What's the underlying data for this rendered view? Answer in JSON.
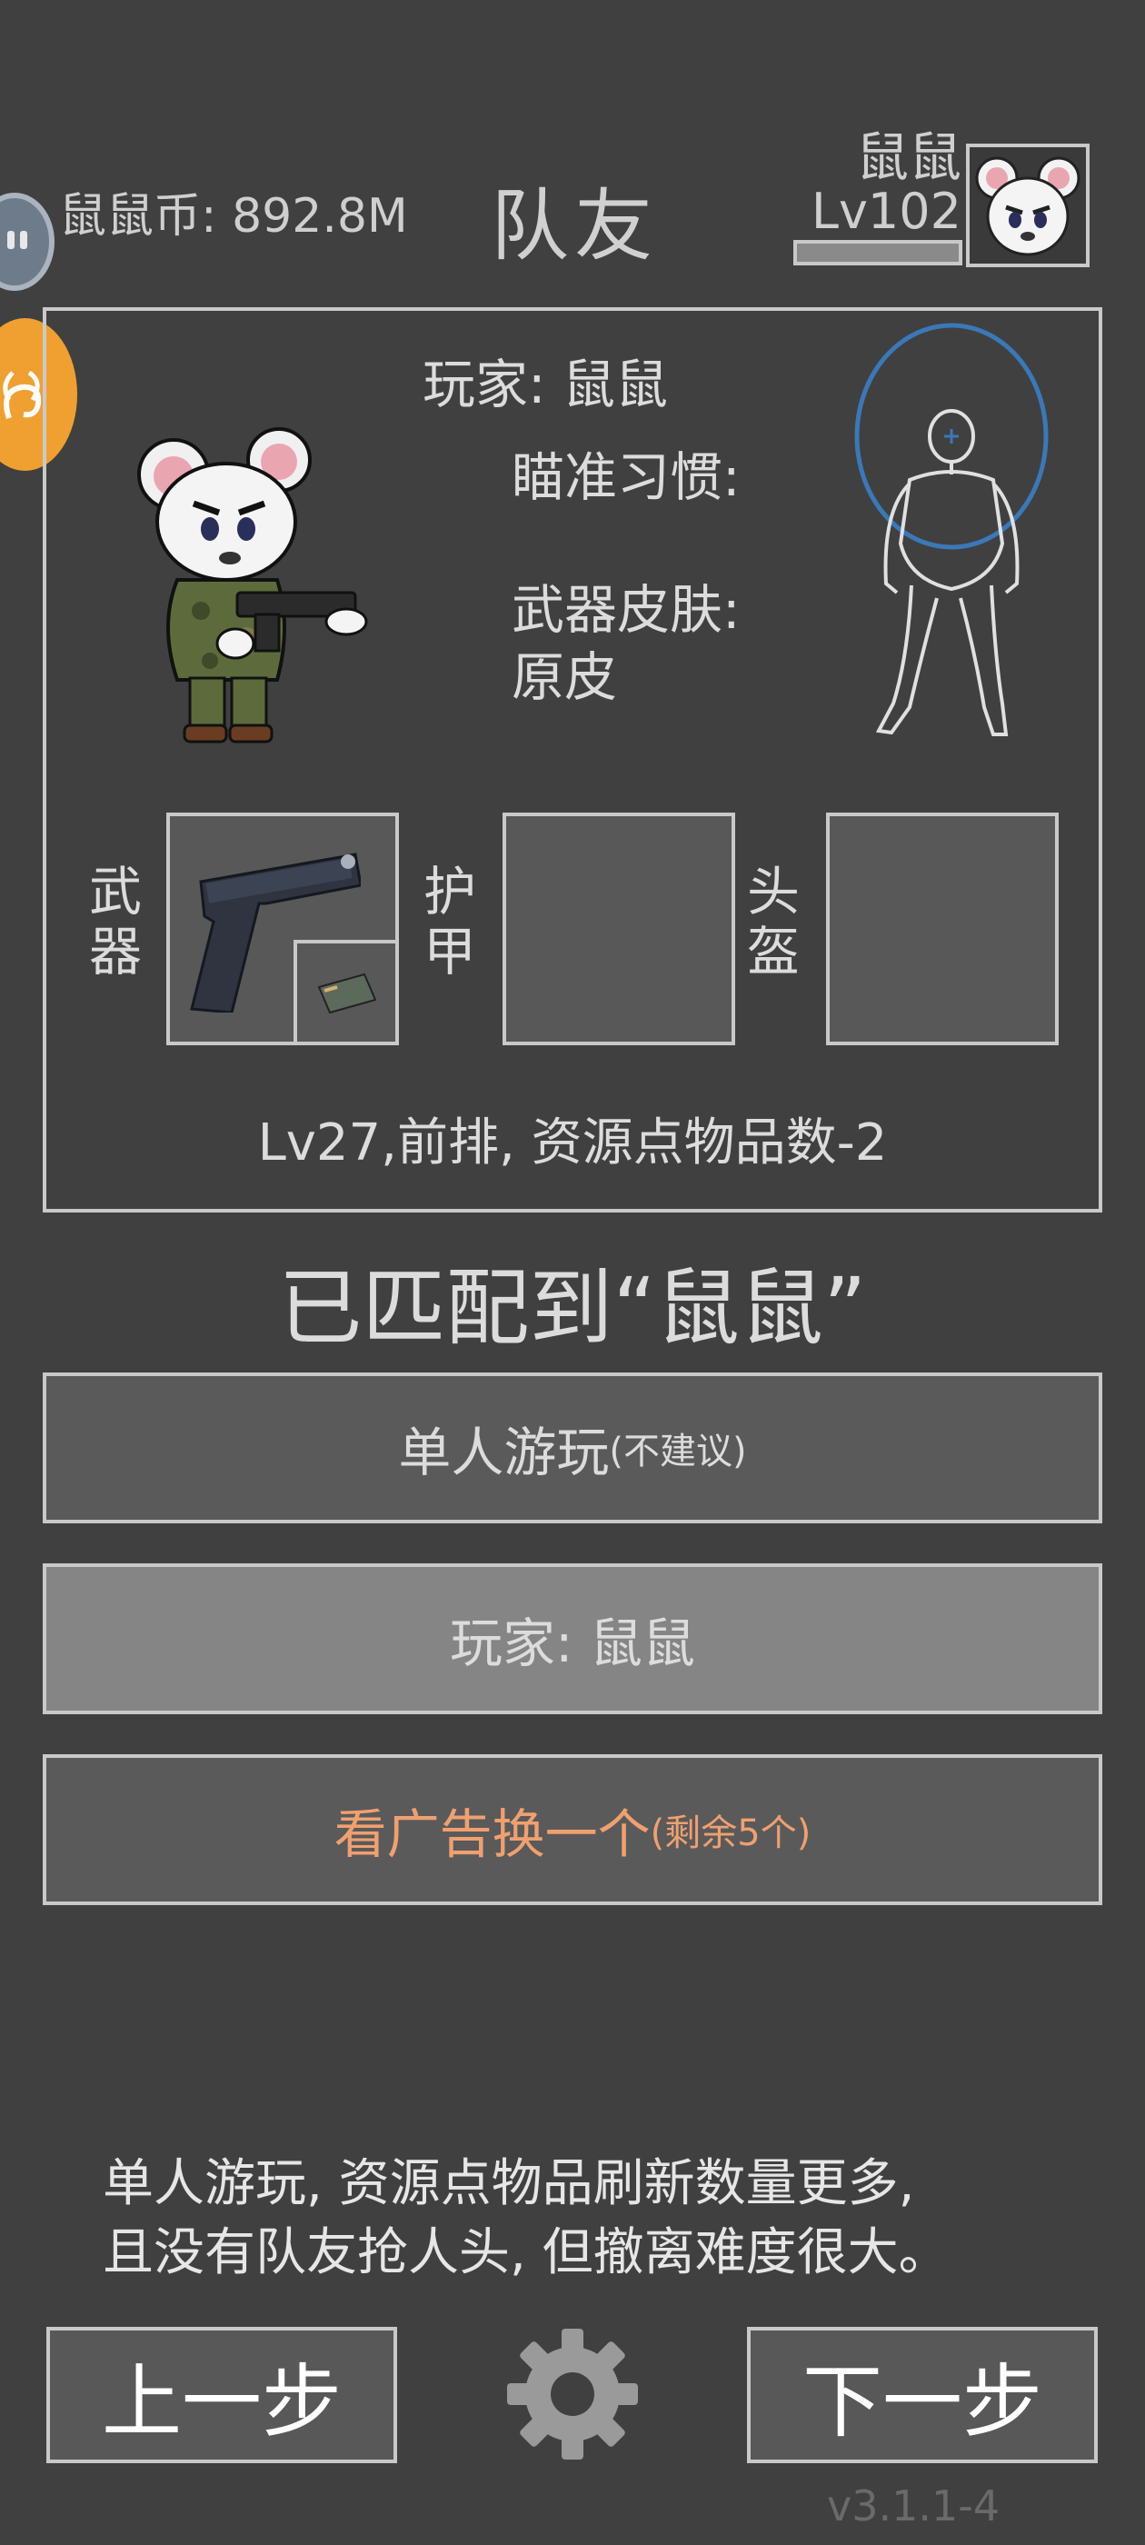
{
  "header": {
    "coins_label": "鼠鼠币:",
    "coins_value": "892.8M",
    "title": "队友",
    "player_name": "鼠鼠",
    "player_level": "Lv102"
  },
  "teammate_card": {
    "player_label": "玩家:",
    "player_name": "鼠鼠",
    "aim_label": "瞄准习惯:",
    "aim_value": "",
    "skin_label": "武器皮肤:",
    "skin_value": "原皮",
    "slots": [
      {
        "label": "武器",
        "chars": [
          "武",
          "器"
        ],
        "item": "pistol-icon",
        "filled": true
      },
      {
        "label": "护甲",
        "chars": [
          "护",
          "甲"
        ],
        "item": "",
        "filled": false
      },
      {
        "label": "头盔",
        "chars": [
          "头",
          "盔"
        ],
        "item": "",
        "filled": false
      }
    ],
    "info": "Lv27,前排, 资源点物品数-2"
  },
  "matched_text": "已匹配到“鼠鼠”",
  "options": [
    {
      "main": "单人游玩",
      "sub": "(不建议)",
      "selected": false
    },
    {
      "main": "玩家: 鼠鼠",
      "sub": "",
      "selected": true
    },
    {
      "main": "看广告换一个",
      "sub": "(剩余5个)",
      "selected": false,
      "color": "#f0a070"
    }
  ],
  "tip": {
    "line1": "单人游玩, 资源点物品刷新数量更多,",
    "line2": "且没有队友抢人头, 但撤离难度很大。"
  },
  "nav": {
    "prev": "上一步",
    "next": "下一步"
  },
  "version": "v3.1.1-4",
  "colors": {
    "background": "#404040",
    "border": "#c9c9c9",
    "accent_orange": "#f0a070",
    "selected_button": "#858585",
    "aim_circle": "#3a78b8"
  }
}
